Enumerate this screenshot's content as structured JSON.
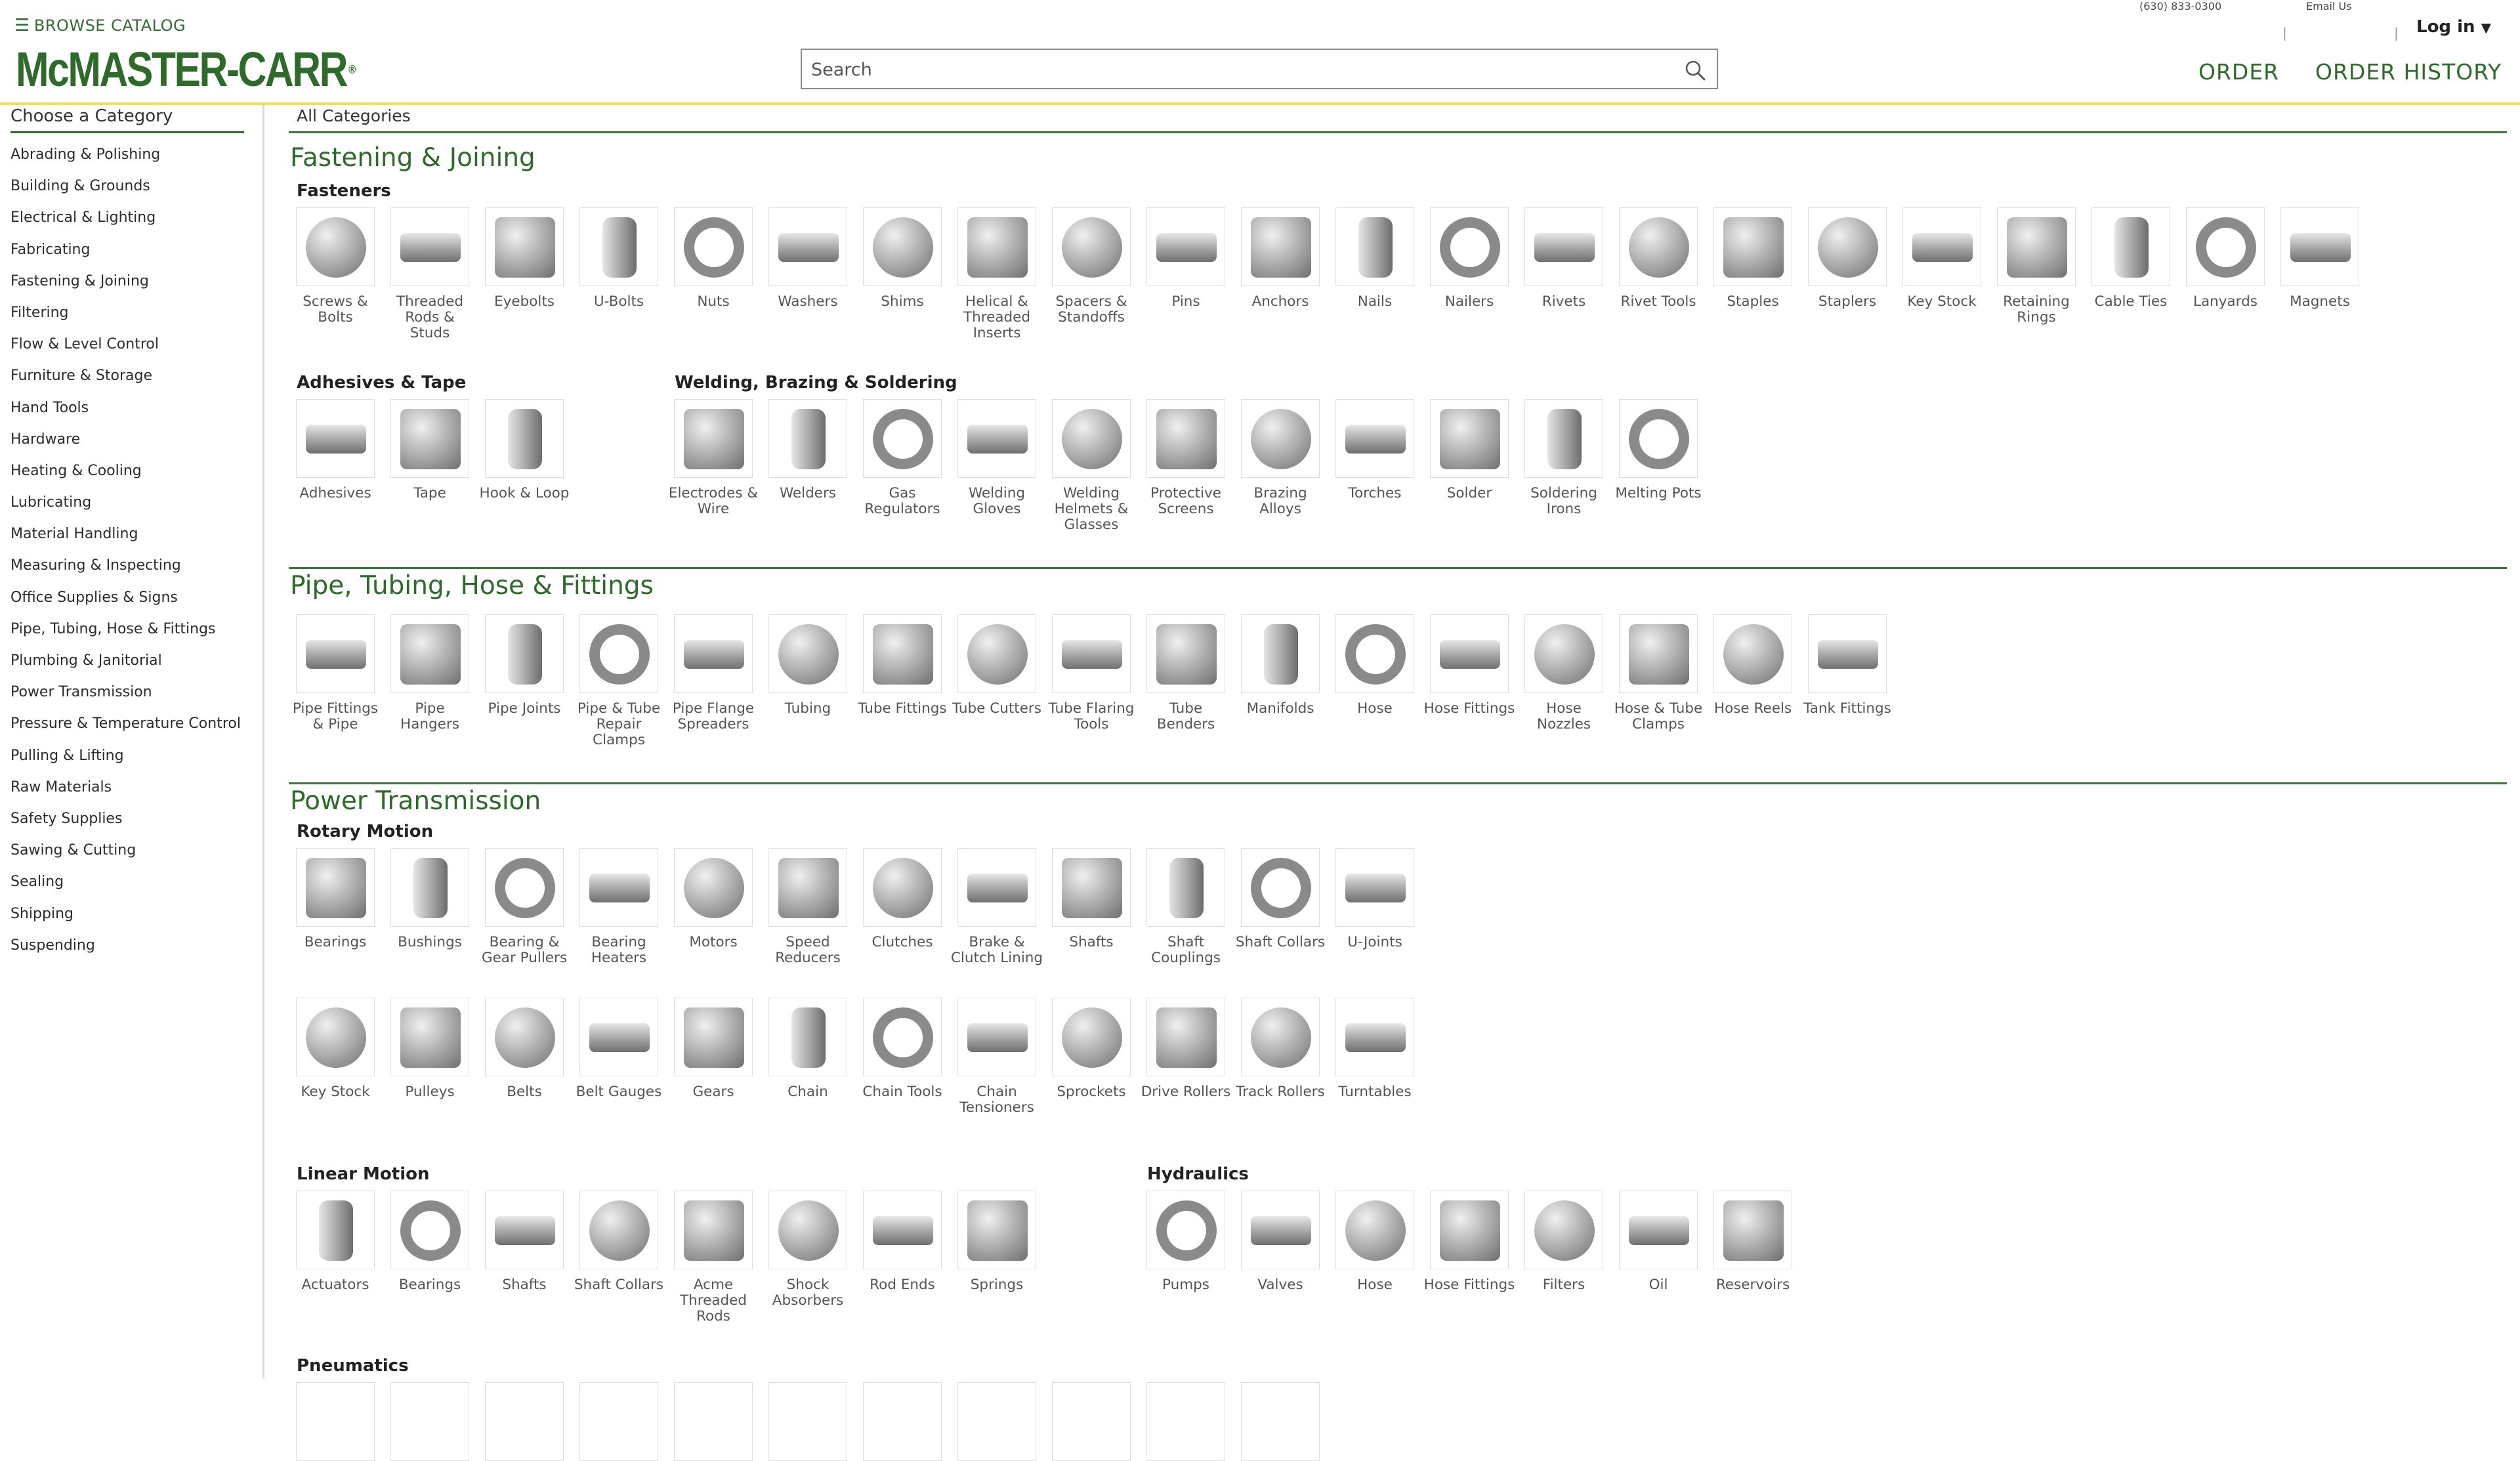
{
  "header": {
    "browse_label": "BROWSE CATALOG",
    "logo_text": "McMASTER-CARR",
    "search": {
      "placeholder": "Search",
      "value": ""
    },
    "phone": "(630) 833-0300",
    "email_label": "Email Us",
    "separator": "|",
    "login_label": "Log in",
    "nav": {
      "order": "ORDER",
      "order_history": "ORDER HISTORY"
    }
  },
  "sidebar": {
    "heading": "Choose a Category",
    "items": [
      "Abrading & Polishing",
      "Building & Grounds",
      "Electrical & Lighting",
      "Fabricating",
      "Fastening & Joining",
      "Filtering",
      "Flow & Level Control",
      "Furniture & Storage",
      "Hand Tools",
      "Hardware",
      "Heating & Cooling",
      "Lubricating",
      "Material Handling",
      "Measuring & Inspecting",
      "Office Supplies & Signs",
      "Pipe, Tubing, Hose & Fittings",
      "Plumbing & Janitorial",
      "Power Transmission",
      "Pressure & Temperature Control",
      "Pulling & Lifting",
      "Raw Materials",
      "Safety Supplies",
      "Sawing & Cutting",
      "Sealing",
      "Shipping",
      "Suspending"
    ]
  },
  "main": {
    "breadcrumb": "All Categories",
    "sections": [
      {
        "title": "Fastening & Joining",
        "groups": [
          {
            "title": "Fasteners",
            "items": [
              "Screws & Bolts",
              "Threaded Rods & Studs",
              "Eyebolts",
              "U-Bolts",
              "Nuts",
              "Washers",
              "Shims",
              "Helical & Threaded Inserts",
              "Spacers & Standoffs",
              "Pins",
              "Anchors",
              "Nails",
              "Nailers",
              "Rivets",
              "Rivet Tools",
              "Staples",
              "Staplers",
              "Key Stock",
              "Retaining Rings",
              "Cable Ties",
              "Lanyards",
              "Magnets"
            ]
          },
          {
            "title": "Adhesives & Tape",
            "items": [
              "Adhesives",
              "Tape",
              "Hook & Loop"
            ]
          },
          {
            "title": "Welding, Brazing & Soldering",
            "items": [
              "Electrodes & Wire",
              "Welders",
              "Gas Regulators",
              "Welding Gloves",
              "Welding Helmets & Glasses",
              "Protective Screens",
              "Brazing Alloys",
              "Torches",
              "Solder",
              "Soldering Irons",
              "Melting Pots"
            ]
          }
        ]
      },
      {
        "title": "Pipe, Tubing, Hose & Fittings",
        "groups": [
          {
            "title": "",
            "items": [
              "Pipe Fittings & Pipe",
              "Pipe Hangers",
              "Pipe Joints",
              "Pipe & Tube Repair Clamps",
              "Pipe Flange Spreaders",
              "Tubing",
              "Tube Fittings",
              "Tube Cutters",
              "Tube Flaring Tools",
              "Tube Benders",
              "Manifolds",
              "Hose",
              "Hose Fittings",
              "Hose Nozzles",
              "Hose & Tube Clamps",
              "Hose Reels",
              "Tank Fittings"
            ]
          }
        ]
      },
      {
        "title": "Power Transmission",
        "groups": [
          {
            "title": "Rotary Motion",
            "items": [
              "Bearings",
              "Bushings",
              "Bearing & Gear Pullers",
              "Bearing Heaters",
              "Motors",
              "Speed Reducers",
              "Clutches",
              "Brake & Clutch Lining",
              "Shafts",
              "Shaft Couplings",
              "Shaft Collars",
              "U-Joints",
              "Key Stock",
              "Pulleys",
              "Belts",
              "Belt Gauges",
              "Gears",
              "Chain",
              "Chain Tools",
              "Chain Tensioners",
              "Sprockets",
              "Drive Rollers",
              "Track Rollers",
              "Turntables"
            ]
          },
          {
            "title": "Linear Motion",
            "items": [
              "Actuators",
              "Bearings",
              "Shafts",
              "Shaft Collars",
              "Acme Threaded Rods",
              "Shock Absorbers",
              "Rod Ends",
              "Springs"
            ]
          },
          {
            "title": "Hydraulics",
            "items": [
              "Pumps",
              "Valves",
              "Hose",
              "Hose Fittings",
              "Filters",
              "Oil",
              "Reservoirs"
            ]
          },
          {
            "title": "Pneumatics",
            "items": []
          }
        ]
      }
    ]
  }
}
